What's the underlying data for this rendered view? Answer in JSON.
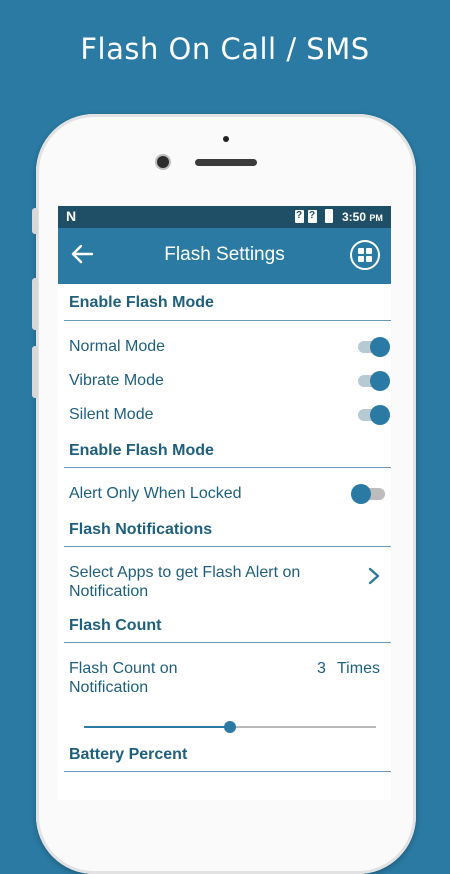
{
  "headline": "Flash On Call / SMS",
  "status_bar": {
    "time": "3:50",
    "ampm": "PM",
    "notification_icon": "N"
  },
  "toolbar": {
    "title": "Flash Settings",
    "back_icon": "arrow-left",
    "grid_icon": "grid-circle"
  },
  "sections": {
    "flash_mode": {
      "header": "Enable Flash Mode",
      "rows": [
        {
          "label": "Normal Mode",
          "on": true
        },
        {
          "label": "Vibrate Mode",
          "on": true
        },
        {
          "label": "Silent Mode",
          "on": true
        }
      ]
    },
    "locked": {
      "header": "Enable Flash Mode",
      "row": {
        "label": "Alert Only When Locked",
        "on": false
      }
    },
    "notifications": {
      "header": "Flash Notifications",
      "row_line1": "Select Apps to get Flash Alert on",
      "row_line2": "Notification"
    },
    "count": {
      "header": "Flash Count",
      "label_line1": "Flash Count on",
      "label_line2": "Notification",
      "value": "3",
      "unit": "Times",
      "slider_fraction": 0.5
    },
    "battery": {
      "header": "Battery Percent"
    }
  },
  "colors": {
    "background": "#2a7aa3",
    "accent": "#2a7aa3",
    "text": "#1f5f7e",
    "status_bar": "#1f4f66"
  }
}
